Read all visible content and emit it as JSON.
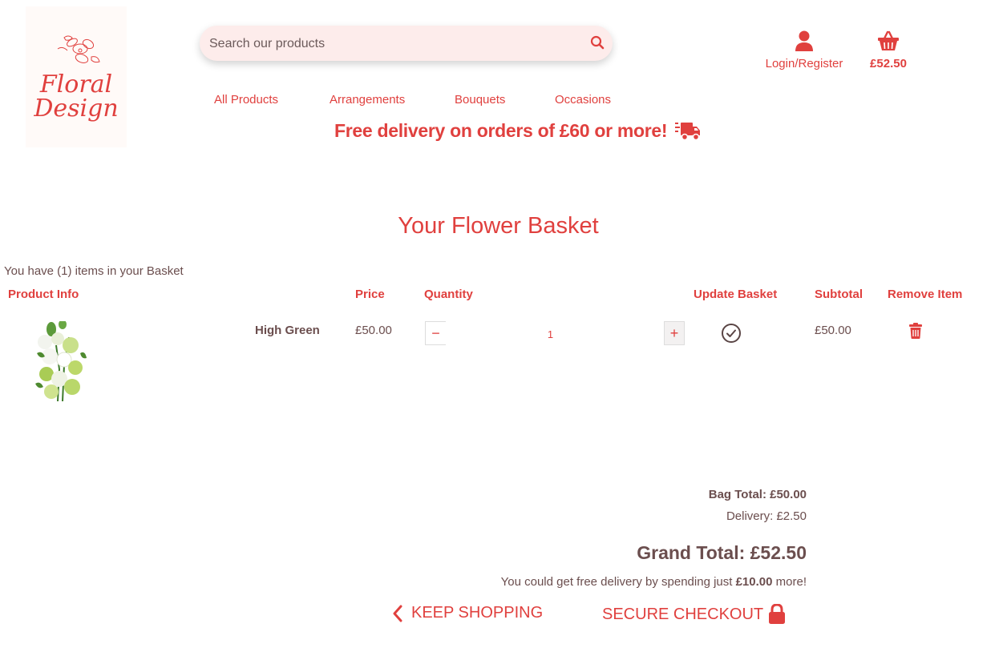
{
  "brand": {
    "logo_line1": "Floral",
    "logo_line2": "Design"
  },
  "search": {
    "placeholder": "Search our products",
    "value": ""
  },
  "header": {
    "account_label": "Login/Register",
    "basket_total": "£52.50"
  },
  "nav": {
    "items": [
      "All Products",
      "Arrangements",
      "Bouquets",
      "Occasions"
    ]
  },
  "promo": {
    "text": "Free delivery on orders of £60 or more!"
  },
  "page": {
    "title": "Your Flower Basket",
    "item_count_text": "You have (1) items in your Basket"
  },
  "table": {
    "headers": {
      "product_info": "Product Info",
      "price": "Price",
      "quantity": "Quantity",
      "update": "Update Basket",
      "subtotal": "Subtotal",
      "remove": "Remove Item"
    },
    "rows": [
      {
        "name": "High Green",
        "price": "£50.00",
        "quantity": "1",
        "subtotal": "£50.00"
      }
    ]
  },
  "totals": {
    "bag_total": "Bag Total: £50.00",
    "delivery": "Delivery: £2.50",
    "grand_total": "Grand Total: £52.50",
    "free_msg_before": "You could get free delivery by spending just ",
    "free_msg_amount": "£10.00",
    "free_msg_after": " more!"
  },
  "actions": {
    "keep_shopping": "KEEP SHOPPING",
    "secure_checkout": "SECURE CHECKOUT"
  },
  "colors": {
    "accent": "#e0403e",
    "text": "#6b4e4e",
    "search_bg": "#fdeceb"
  }
}
